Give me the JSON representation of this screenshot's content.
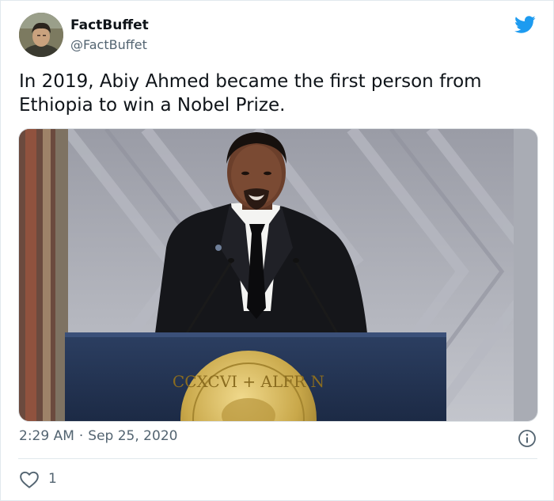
{
  "tweet": {
    "display_name": "FactBuffet",
    "handle": "@FactBuffet",
    "text": "In 2019, Abiy Ahmed became the first person from Ethiopia to win a Nobel Prize.",
    "time": "2:29 AM",
    "separator": "·",
    "date": "Sep 25, 2020",
    "like_count": "1"
  },
  "medal_text": "CCXCVI + ALFR N",
  "colors": {
    "twitter_blue": "#1d9bf0",
    "muted_text": "#536471",
    "podium_navy": "#243553",
    "medal_gold": "#c9a84a"
  },
  "icons": {
    "brand": "twitter-bird-icon",
    "info": "info-icon",
    "like": "heart-icon"
  }
}
